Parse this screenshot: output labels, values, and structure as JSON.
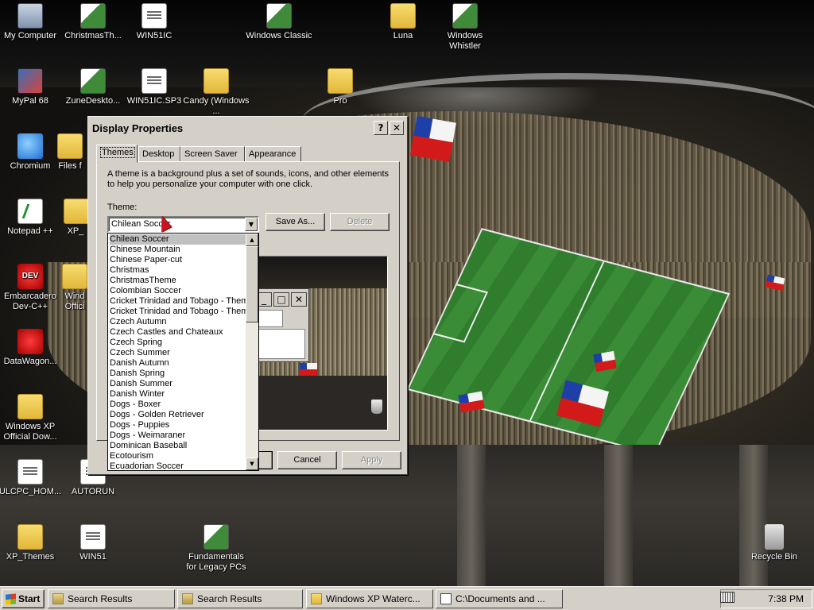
{
  "desktop": {
    "icons": [
      {
        "label": "My Computer",
        "icon": "computer-icon"
      },
      {
        "label": "ChristmasTh...",
        "icon": "theme-icon"
      },
      {
        "label": "WIN51IC",
        "icon": "document-icon"
      },
      {
        "label": "Windows Classic",
        "icon": "theme-icon"
      },
      {
        "label": "Luna",
        "icon": "folder-icon"
      },
      {
        "label": "Windows Whistler",
        "icon": "theme-icon"
      },
      {
        "label": "MyPal 68",
        "icon": "browser-icon"
      },
      {
        "label": "ZuneDeskto...",
        "icon": "theme-icon"
      },
      {
        "label": "WIN51IC.SP3",
        "icon": "document-icon"
      },
      {
        "label": "Candy (Windows ...",
        "icon": "folder-icon"
      },
      {
        "label": "Pro",
        "icon": "folder-icon"
      },
      {
        "label": "Chromium",
        "icon": "globe-icon"
      },
      {
        "label": "Files f",
        "icon": "folder-icon"
      },
      {
        "label": "Notepad ++",
        "icon": "notepad-icon"
      },
      {
        "label": "XP_",
        "icon": "folder-icon"
      },
      {
        "label": "Embarcadero Dev-C++",
        "icon": "devcpp-icon"
      },
      {
        "label": "Wind Offici",
        "icon": "folder-icon"
      },
      {
        "label": "DataWagon...",
        "icon": "datawagon-icon"
      },
      {
        "label": "Windows XP Official Dow...",
        "icon": "zip-folder-icon"
      },
      {
        "label": "ULCPC_HOM...",
        "icon": "document-icon"
      },
      {
        "label": "AUTORUN",
        "icon": "document-icon"
      },
      {
        "label": "XP_Themes",
        "icon": "zip-folder-icon"
      },
      {
        "label": "WIN51",
        "icon": "document-icon"
      },
      {
        "label": "Fundamentals for Legacy PCs",
        "icon": "theme-icon"
      },
      {
        "label": "Recycle Bin",
        "icon": "recycle-bin-icon"
      }
    ]
  },
  "dialog": {
    "title": "Display Properties",
    "help_label": "?",
    "close_label": "✕",
    "tabs": [
      {
        "label": "Themes",
        "active": true
      },
      {
        "label": "Desktop"
      },
      {
        "label": "Screen Saver"
      },
      {
        "label": "Appearance"
      }
    ],
    "description": "A theme is a background plus a set of sounds, icons, and other elements to help you personalize your computer with one click.",
    "theme_label": "Theme:",
    "theme_value": "Chilean Soccer",
    "save_as_label": "Save As...",
    "delete_label": "Delete",
    "cancel_label": "Cancel",
    "apply_label": "Apply",
    "dropdown_items": [
      "Chilean Soccer",
      "Chinese Mountain",
      "Chinese Paper-cut",
      "Christmas",
      "ChristmasTheme",
      "Colombian Soccer",
      "Cricket Trinidad and Tobago - Them",
      "Cricket Trinidad and Tobago - Them",
      "Czech Autumn",
      "Czech Castles and Chateaux",
      "Czech Spring",
      "Czech Summer",
      "Danish Autumn",
      "Danish Spring",
      "Danish Summer",
      "Danish Winter",
      "Dogs - Boxer",
      "Dogs - Golden Retriever",
      "Dogs - Puppies",
      "Dogs - Weimaraner",
      "Dominican Baseball",
      "Ecotourism",
      "Ecuadorian Soccer"
    ],
    "selected_item_index": 0
  },
  "taskbar": {
    "start_label": "Start",
    "tasks": [
      {
        "label": "Search Results"
      },
      {
        "label": "Search Results"
      },
      {
        "label": "Windows XP Waterc..."
      },
      {
        "label": "C:\\Documents and ..."
      }
    ],
    "tray_chevron": "«",
    "clock": "7:38 PM"
  },
  "colors": {
    "window_face": "#d4d0c8",
    "selection": "#c0c0c0",
    "field_green": "#3a8c36",
    "flag_red": "#d21a1a",
    "flag_blue": "#1f3fa8"
  }
}
